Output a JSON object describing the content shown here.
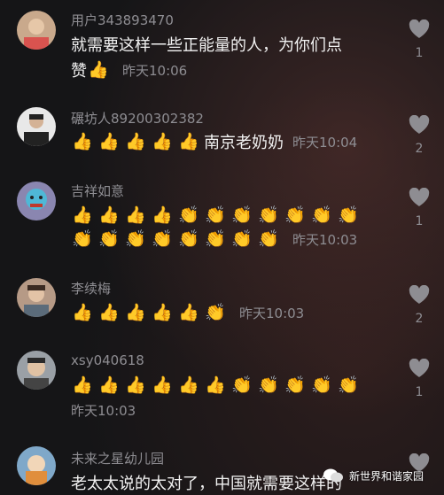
{
  "comments": [
    {
      "user": "用户343893470",
      "lines": [
        {
          "text": "就需要这样一些正能量的人，为你们点",
          "emoji": [],
          "time": ""
        },
        {
          "text": "赞",
          "emoji": [
            "👍"
          ],
          "time": "昨天10:06"
        }
      ],
      "likes": "1",
      "avatar_color": "#c9a98c"
    },
    {
      "user": "碾坊人89200302382",
      "lines": [
        {
          "text": "",
          "emoji": [
            "👍",
            "👍",
            "👍",
            "👍",
            "👍"
          ],
          "time": "昨天10:04",
          "tail": "南京老奶奶"
        }
      ],
      "likes": "2",
      "avatar_color": "#e8e8e8"
    },
    {
      "user": "吉祥如意",
      "lines": [
        {
          "text": "",
          "emoji": [
            "👍",
            "👍",
            "👍",
            "👍",
            "👏",
            "👏",
            "👏",
            "👏",
            "👏",
            "👏",
            "👏"
          ],
          "time": ""
        },
        {
          "text": "",
          "emoji": [
            "👏",
            "👏",
            "👏",
            "👏",
            "👏",
            "👏",
            "👏",
            "👏"
          ],
          "time": "昨天10:03"
        }
      ],
      "likes": "1",
      "avatar_color": "#8a86b0"
    },
    {
      "user": "李续梅",
      "lines": [
        {
          "text": "",
          "emoji": [
            "👍",
            "👍",
            "👍",
            "👍",
            "👍",
            "👏"
          ],
          "time": "昨天10:03"
        }
      ],
      "likes": "2",
      "avatar_color": "#b69a86"
    },
    {
      "user": "xsy040618",
      "lines": [
        {
          "text": "",
          "emoji": [
            "👍",
            "👍",
            "👍",
            "👍",
            "👍",
            "👍",
            "👏",
            "👏",
            "👏",
            "👏",
            "👏"
          ],
          "time": ""
        },
        {
          "text": "",
          "emoji": [],
          "time": "昨天10:03"
        }
      ],
      "likes": "1",
      "avatar_color": "#9aa0a6"
    },
    {
      "user": "未来之星幼儿园",
      "lines": [
        {
          "text": "老太太说的太对了，中国就需要这样的",
          "emoji": [],
          "time": ""
        }
      ],
      "likes": "",
      "avatar_color": "#7fa8c9"
    }
  ],
  "watermark": {
    "text": "新世界和谐家园"
  },
  "colors": {
    "like_icon": "#8e8d92",
    "username": "#8e8d92",
    "text": "#f2f2f2"
  }
}
